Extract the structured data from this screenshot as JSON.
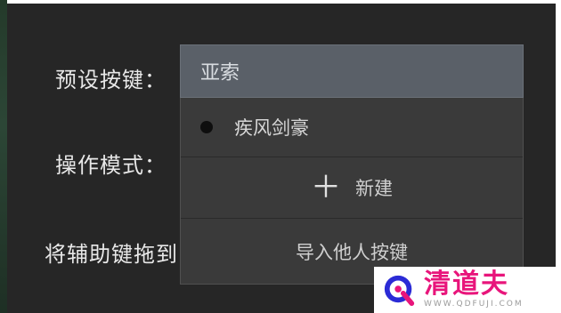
{
  "labels": {
    "preset": "预设按键：",
    "mode": "操作模式：",
    "drag": "将辅助键拖到"
  },
  "preset_select": {
    "value": "亚索"
  },
  "dropdown": {
    "options": [
      {
        "label": "疾风剑豪",
        "icon": "radio-dot-icon"
      },
      {
        "label": "新建",
        "icon": "plus-icon"
      },
      {
        "label": "导入他人按键"
      }
    ]
  },
  "watermark": {
    "brand": "清道夫",
    "url": "WWW.QDFUJI.COM",
    "colors": {
      "brand": "#e8157b",
      "logo_blue": "#2b2bd6"
    }
  },
  "colors": {
    "panel_bg": "#262626",
    "select_bg": "#5a6068",
    "dropdown_bg": "#3a3a3a"
  }
}
